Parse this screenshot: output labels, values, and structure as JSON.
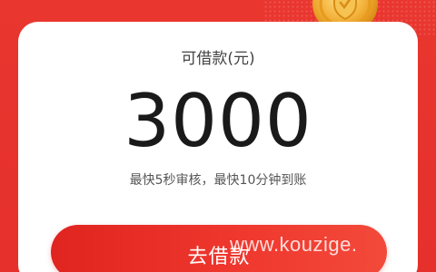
{
  "loan": {
    "title": "可借款(元)",
    "amount": "3000",
    "subtext": "最快5秒审核，最快10分钟到账"
  },
  "actions": {
    "borrow_label": "去借款"
  },
  "watermark": {
    "text": "www.kouzige."
  },
  "colors": {
    "background_red": "#e5302b",
    "button_red": "#ef3a30",
    "coin_gold": "#f3b23a"
  }
}
